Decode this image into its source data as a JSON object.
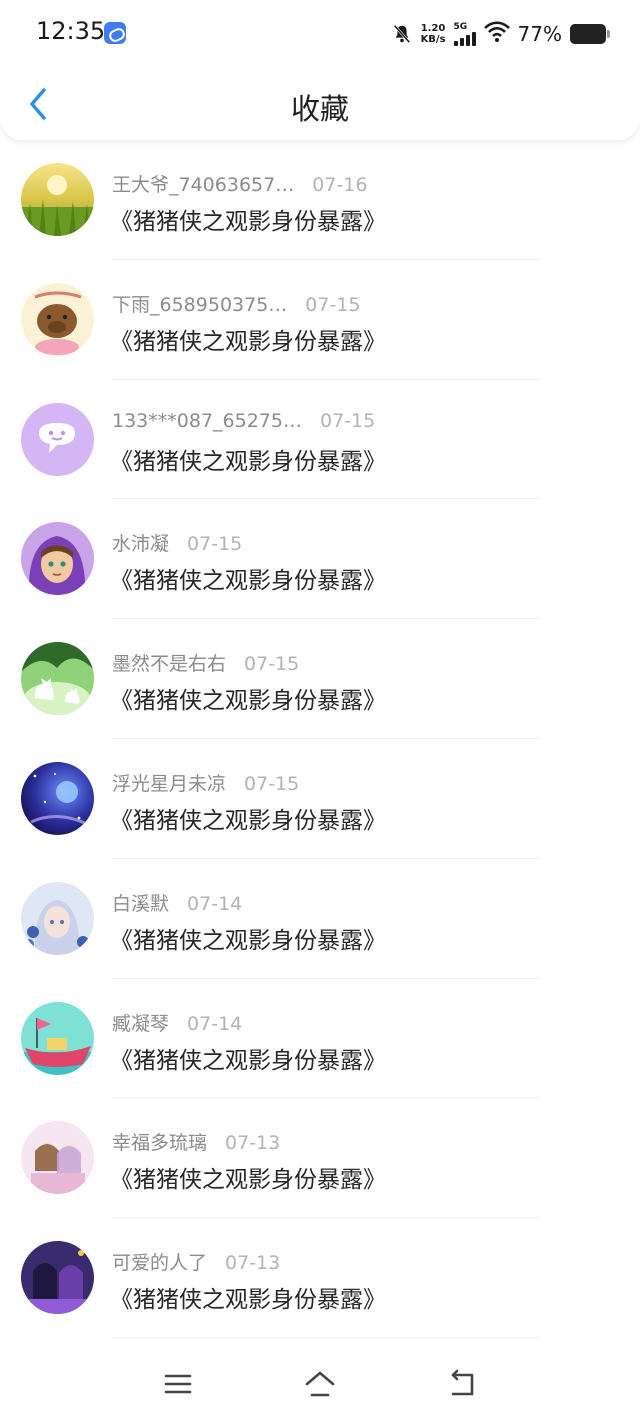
{
  "status_bar": {
    "time": "12:35",
    "net_speed_value": "1.20",
    "net_speed_unit": "KB/s",
    "network_type": "5G",
    "battery_percent": "77%",
    "battery_level": 0.77
  },
  "header": {
    "title": "收藏"
  },
  "items": [
    {
      "username": "王大爷_74063657…",
      "date": "07-16",
      "title": "《猪猪侠之观影身份暴露》",
      "avatar": "meadow-avatar"
    },
    {
      "username": "下雨_658950375…",
      "date": "07-15",
      "title": "《猪猪侠之观影身份暴露》",
      "avatar": "capybara-avatar"
    },
    {
      "username": "133***087_65275…",
      "date": "07-15",
      "title": "《猪猪侠之观影身份暴露》",
      "avatar": "chat-bubble-avatar"
    },
    {
      "username": "水沛凝",
      "date": "07-15",
      "title": "《猪猪侠之观影身份暴露》",
      "avatar": "anime-girl-hood-avatar"
    },
    {
      "username": "墨然不是右右",
      "date": "07-15",
      "title": "《猪猪侠之观影身份暴露》",
      "avatar": "cats-green-avatar"
    },
    {
      "username": "浮光星月未凉",
      "date": "07-15",
      "title": "《猪猪侠之观影身份暴露》",
      "avatar": "starry-sky-avatar"
    },
    {
      "username": "白溪默",
      "date": "07-14",
      "title": "《猪猪侠之观影身份暴露》",
      "avatar": "anime-girl-flowers-avatar"
    },
    {
      "username": "臧凝琴",
      "date": "07-14",
      "title": "《猪猪侠之观影身份暴露》",
      "avatar": "boat-cartoon-avatar"
    },
    {
      "username": "幸福多琉璃",
      "date": "07-13",
      "title": "《猪猪侠之观影身份暴露》",
      "avatar": "pastel-girls-avatar"
    },
    {
      "username": "可爱的人了",
      "date": "07-13",
      "title": "《猪猪侠之观影身份暴露》",
      "avatar": "anime-girls-dark-avatar"
    }
  ],
  "colors": {
    "accent": "#2f8fe6",
    "title_text": "#262626",
    "meta_text": "#8c8c8c",
    "date_text": "#b3b3b3"
  }
}
